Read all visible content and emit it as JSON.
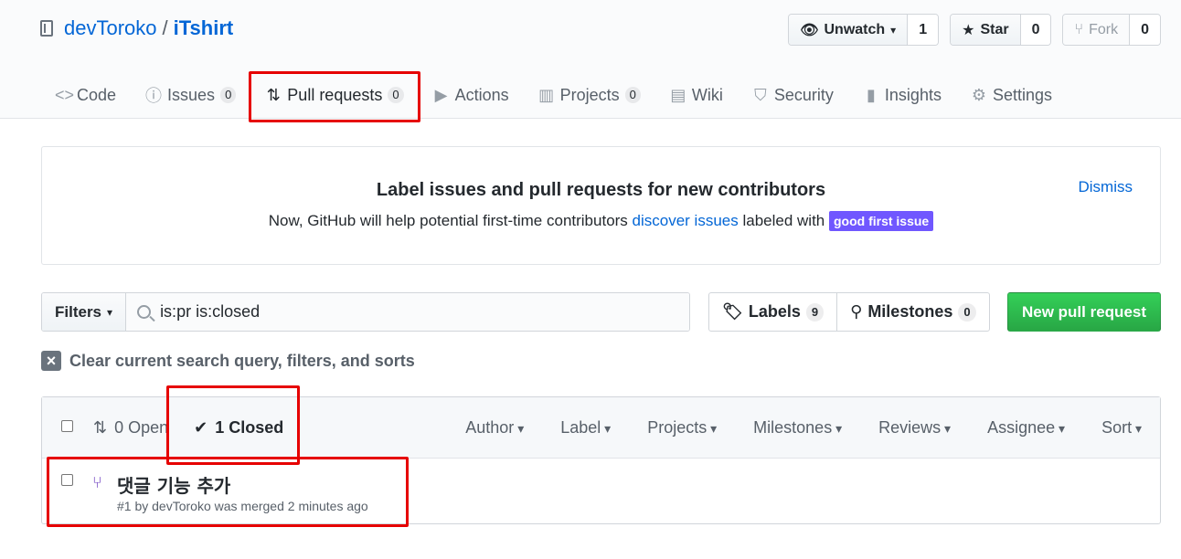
{
  "repo": {
    "owner": "devToroko",
    "separator": "/",
    "name": "iTshirt"
  },
  "actions": {
    "watch": {
      "label": "Unwatch",
      "count": "1"
    },
    "star": {
      "label": "Star",
      "count": "0"
    },
    "fork": {
      "label": "Fork",
      "count": "0"
    }
  },
  "tabs": [
    {
      "label": "Code",
      "icon": "code-icon"
    },
    {
      "label": "Issues",
      "counter": "0",
      "icon": "issue-icon"
    },
    {
      "label": "Pull requests",
      "counter": "0",
      "icon": "pull-request-icon",
      "selected": true
    },
    {
      "label": "Actions",
      "icon": "play-icon"
    },
    {
      "label": "Projects",
      "counter": "0",
      "icon": "project-icon"
    },
    {
      "label": "Wiki",
      "icon": "book-icon"
    },
    {
      "label": "Security",
      "icon": "shield-icon"
    },
    {
      "label": "Insights",
      "icon": "graph-icon"
    },
    {
      "label": "Settings",
      "icon": "gear-icon"
    }
  ],
  "banner": {
    "title": "Label issues and pull requests for new contributors",
    "text_before": "Now, GitHub will help potential first-time contributors ",
    "link": "discover issues",
    "text_after": " labeled with ",
    "label": "good first issue",
    "dismiss": "Dismiss"
  },
  "subnav": {
    "filters_label": "Filters",
    "search_value": "is:pr is:closed",
    "labels_label": "Labels",
    "labels_count": "9",
    "milestones_label": "Milestones",
    "milestones_count": "0",
    "new_pr_label": "New pull request"
  },
  "clear_query": "Clear current search query, filters, and sorts",
  "table": {
    "open_label": "0 Open",
    "closed_label": "1 Closed",
    "filters": [
      "Author",
      "Label",
      "Projects",
      "Milestones",
      "Reviews",
      "Assignee",
      "Sort"
    ],
    "rows": [
      {
        "title": "댓글 기능 추가",
        "meta": "#1 by devToroko was merged 2 minutes ago"
      }
    ]
  },
  "colors": {
    "link": "#0366d6",
    "highlight": "#e60000",
    "good_first_issue": "#7057ff",
    "merged": "#6f42c1",
    "primary_button": "#28a745"
  }
}
